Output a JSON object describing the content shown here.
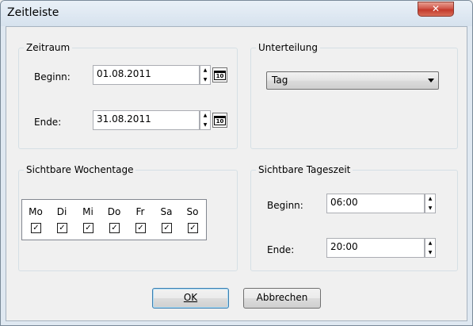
{
  "window": {
    "title": "Zeitleiste",
    "close_label": "✕"
  },
  "zeitraum": {
    "title": "Zeitraum",
    "begin_label": "Beginn:",
    "begin_value": "01.08.2011",
    "end_label": "Ende:",
    "end_value": "31.08.2011",
    "calendar_text": "10"
  },
  "unterteilung": {
    "title": "Unterteilung",
    "selected": "Tag"
  },
  "wochentage": {
    "title": "Sichtbare Wochentage",
    "days": [
      {
        "label": "Mo",
        "checked": true
      },
      {
        "label": "Di",
        "checked": true
      },
      {
        "label": "Mi",
        "checked": true
      },
      {
        "label": "Do",
        "checked": true
      },
      {
        "label": "Fr",
        "checked": true
      },
      {
        "label": "Sa",
        "checked": true
      },
      {
        "label": "So",
        "checked": true
      }
    ]
  },
  "tageszeit": {
    "title": "Sichtbare Tageszeit",
    "begin_label": "Beginn:",
    "begin_value": "06:00",
    "end_label": "Ende:",
    "end_value": "20:00"
  },
  "buttons": {
    "ok": "OK",
    "cancel": "Abbrechen"
  }
}
